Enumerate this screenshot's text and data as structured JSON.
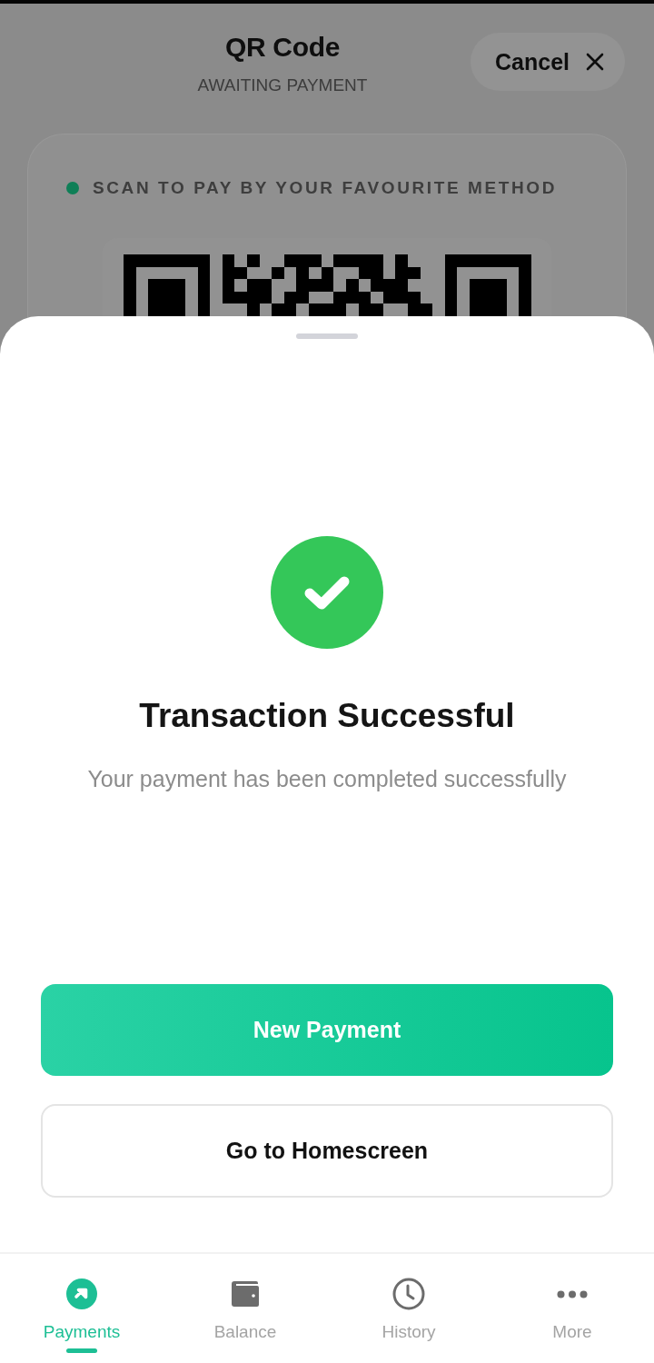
{
  "header": {
    "title": "QR Code",
    "subtitle": "AWAITING PAYMENT",
    "cancel_button": {
      "label": "Cancel"
    }
  },
  "qr_card": {
    "instruction": "SCAN TO PAY BY YOUR FAVOURITE METHOD"
  },
  "success_sheet": {
    "title": "Transaction Successful",
    "message": "Your payment has been completed successfully",
    "buttons": [
      {
        "label": "New Payment",
        "kind": "primary"
      },
      {
        "label": "Go to Homescreen",
        "kind": "secondary"
      }
    ]
  },
  "bottom_nav": [
    {
      "label": "Payments",
      "selected": true
    },
    {
      "label": "Balance",
      "selected": false
    },
    {
      "label": "History",
      "selected": false
    },
    {
      "label": "More",
      "selected": false
    }
  ]
}
